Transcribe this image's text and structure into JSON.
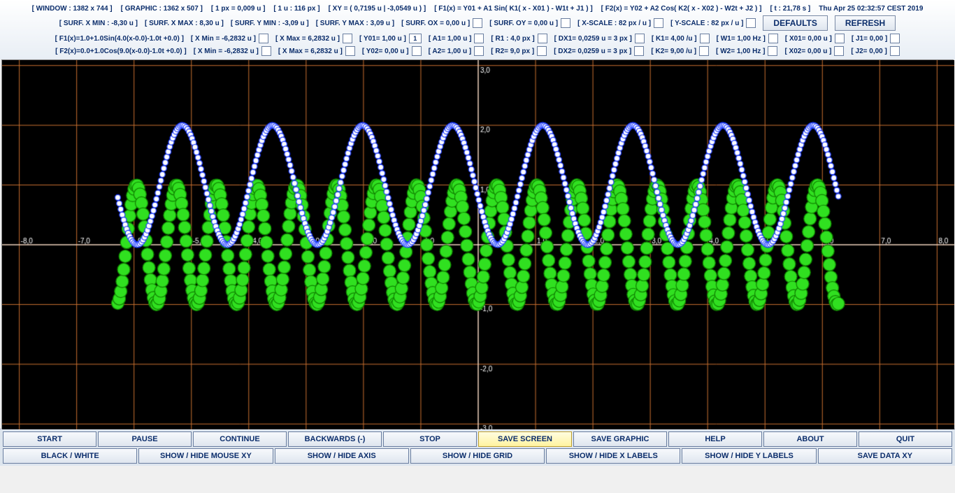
{
  "header": {
    "window": "[ WINDOW : 1382 x 744 ]",
    "graphic": "[ GRAPHIC : 1362 x 507 ]",
    "pxu": "[ 1 px = 0,009 u ]",
    "upx": "[ 1 u : 116 px ]",
    "xy": "[ XY = ( 0,7195 u | -3,0549 u ) ]",
    "f1": "[ F1(x) = Y01 + A1 Sin(  K1( x - X01 ) - W1t + J1  ) ]",
    "f2": "[ F2(x) = Y02 + A2 Cos(  K2( x - X02 ) - W2t + J2  ) ]",
    "time": "[ t : 21,78 s ]",
    "date": "Thu Apr 25 02:32:57 CEST 2019"
  },
  "row2": {
    "sxmin": "[ SURF. X MIN : -8,30 u ]",
    "sxmax": "[ SURF. X MAX : 8,30 u ]",
    "symin": "[ SURF. Y MIN : -3,09 u ]",
    "symax": "[ SURF. Y MAX : 3,09 u ]",
    "sox": "[ SURF. OX =  0,00 u ]",
    "soy": "[ SURF. OY =  0,00 u ]",
    "xscale": "[ X-SCALE : 82 px / u ]",
    "yscale": "[ Y-SCALE : 82 px / u ]",
    "defaults": "DEFAULTS",
    "refresh": "REFRESH"
  },
  "row3": {
    "func": "[ F1(x)=1.0+1.0Sin(4.0(x-0.0)-1.0t +0.0) ]",
    "xmin": "[ X Min = -6,2832 u ]",
    "xmax": "[ X Max = 6,2832 u ]",
    "y0": "[ Y01= 1,00 u ]",
    "y0val": "1",
    "a": "[ A1= 1,00 u ]",
    "r": "[ R1 : 4,0 px ]",
    "dx": "[ DX1= 0,0259 u  =  3 px ]",
    "k": "[ K1= 4,00 /u ]",
    "w": "[ W1= 1,00 Hz ]",
    "x0": "[ X01= 0,00 u ]",
    "j": "[ J1= 0,00 ]"
  },
  "row4": {
    "func": "[ F2(x)=0.0+1.0Cos(9.0(x-0.0)-1.0t +0.0) ]",
    "xmin": "[ X Min = -6,2832 u ]",
    "xmax": "[ X Max = 6,2832 u ]",
    "y0": "[ Y02= 0,00 u ]",
    "a": "[ A2= 1,00 u ]",
    "r": "[ R2= 9,0 px ]",
    "dx": "[ DX2= 0,0259 u  =  3 px ]",
    "k": "[ K2= 9,00 /u ]",
    "w": "[ W2= 1,00 Hz ]",
    "x0": "[ X02= 0,00 u ]",
    "j": "[ J2= 0,00 ]"
  },
  "buttons_top": [
    "START",
    "PAUSE",
    "CONTINUE",
    "BACKWARDS (-)",
    "STOP",
    "SAVE SCREEN",
    "SAVE GRAPHIC",
    "HELP",
    "ABOUT",
    "QUIT"
  ],
  "buttons_top_highlight": 5,
  "buttons_bot": [
    "BLACK / WHITE",
    "SHOW / HIDE MOUSE XY",
    "SHOW / HIDE AXIS",
    "SHOW / HIDE GRID",
    "SHOW / HIDE X LABELS",
    "SHOW / HIDE Y LABELS",
    "SAVE DATA XY"
  ],
  "chart_data": {
    "type": "scatter",
    "title": "",
    "xlim": [
      -8.3,
      8.3
    ],
    "ylim": [
      -3.09,
      3.09
    ],
    "xgrid": 1.0,
    "ygrid": 1.0,
    "xlabels": [
      -8,
      -7,
      -6,
      -5,
      -4,
      -3,
      -2,
      -1,
      0,
      1,
      2,
      3,
      4,
      5,
      6,
      7,
      8
    ],
    "ylabels": [
      -3,
      -2,
      -1,
      0,
      1,
      2,
      3
    ],
    "series": [
      {
        "name": "F1",
        "color": "#1030ff",
        "radius_px": 4,
        "fill": "white",
        "stroke": "#1030ff",
        "func": "1.0 + 1.0*sin(4.0*x - 21.78)",
        "x_range": [
          -6.2832,
          6.2832
        ],
        "dx": 0.0259
      },
      {
        "name": "F2",
        "color": "#30e020",
        "radius_px": 9,
        "fill": "#30e020",
        "stroke": "#108000",
        "func": "0.0 + 1.0*cos(9.0*x - 21.78)",
        "x_range": [
          -6.2832,
          6.2832
        ],
        "dx": 0.0259
      }
    ]
  }
}
